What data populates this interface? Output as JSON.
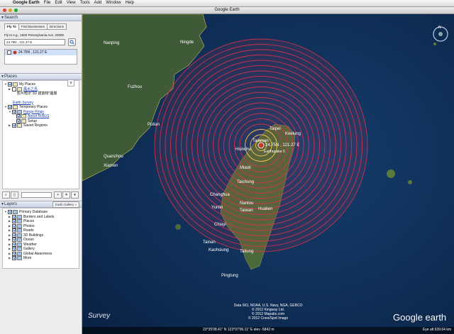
{
  "menubar": {
    "items": [
      "Google Earth",
      "File",
      "Edit",
      "View",
      "Tools",
      "Add",
      "Window",
      "Help"
    ]
  },
  "window": {
    "title": "Google Earth"
  },
  "search": {
    "header": "Search",
    "tabs": [
      "Fly To",
      "Find Businesses",
      "Directions"
    ],
    "fly_label": "Fly to e.g., 1600 Pennsylvania Ave, 20006",
    "input_value": "24.75N , 121.27 E",
    "result": "24.75N , 121.27 E",
    "close_label": "x"
  },
  "places": {
    "header": "Places",
    "items": [
      {
        "label": "My Places",
        "indent": 0,
        "link": false
      },
      {
        "label": "風水之島",
        "indent": 1,
        "link": true
      },
      {
        "label": "影片暗示\"3D 建築物\"圖層",
        "indent": 1,
        "link": false
      },
      {
        "label": "Earth Survey",
        "indent": 1,
        "link": true
      },
      {
        "label": "Temporary Places",
        "indent": 0,
        "link": false
      },
      {
        "label": "Range Rings",
        "indent": 1,
        "link": true
      },
      {
        "label": "About RINGS",
        "indent": 2,
        "link": true
      },
      {
        "label": "Setup",
        "indent": 2,
        "link": false
      },
      {
        "label": "Saved Regions",
        "indent": 1,
        "link": false
      }
    ]
  },
  "layers": {
    "header": "Layers",
    "gallery": "Earth Gallery »",
    "items": [
      "Primary Database",
      "Borders and Labels",
      "Places",
      "Photos",
      "Roads",
      "3D Buildings",
      "Ocean",
      "Weather",
      "Gallery",
      "Global Awareness",
      "More"
    ]
  },
  "map": {
    "place_labels": {
      "nanping": "Nanping",
      "ningde": "Ningde",
      "fuzhou": "Fuzhou",
      "putian": "Putian",
      "quanzhou": "Quanzhou",
      "xiamen": "Xiamen",
      "taipei": "Taipei",
      "keelung": "Keelung",
      "taoyuan": "Taoyuan",
      "hsinchu": "Hsinchu",
      "miaoli": "Miaoli",
      "taichung": "Taichung",
      "changhua": "Changhua",
      "yunlin": "Yunlin",
      "nantou": "Nantou",
      "taiwan": "Taiwan",
      "hualien": "Hualien",
      "chiayi": "Chiayi",
      "tainan": "Tainan",
      "kaohsiung": "Kaohsiung",
      "taitung": "Taitung",
      "pingtung": "Pingtung"
    },
    "marker_label": "24.75N , 121.27 E",
    "marker_sublabel": "Earthquake 5",
    "attribution": "Data SIO, NOAA, U.S. Navy, NGA, GEBCO\n© 2012 Kingway Ltd.\n© 2012 Mapabc.com\n© 2012 Cnes/Spot Image",
    "survey_logo": "Survey",
    "logo": "Google earth",
    "status": "23°35'08.41\" N 123°07'06.11\" E elev -5842 m",
    "eye_alt": "Eye alt  639.64 km",
    "colors": {
      "ring": "#d8334a",
      "inner_ring": "#ffd24a",
      "sea": "#0d2c56",
      "land": "#3d5638"
    }
  }
}
